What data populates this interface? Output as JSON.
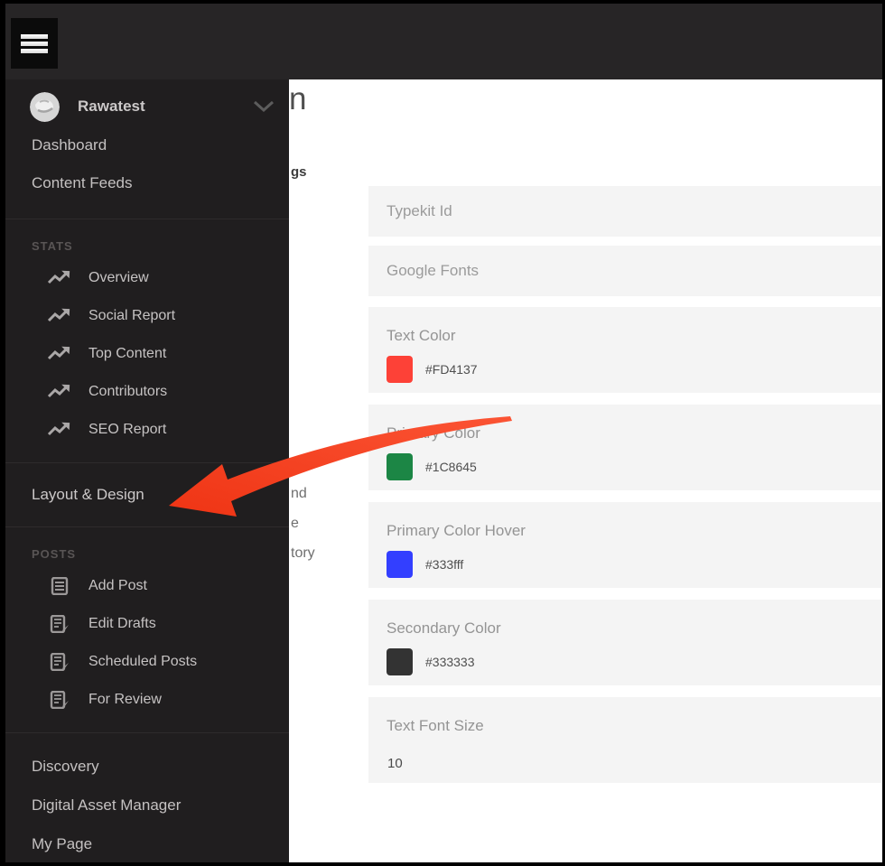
{
  "header": {
    "hamburger_icon": "menu-icon"
  },
  "sidebar": {
    "account": {
      "name": "Rawatest",
      "chevron_icon": "chevron-down"
    },
    "top_items": {
      "dashboard": "Dashboard",
      "content_feeds": "Content Feeds"
    },
    "stats": {
      "title": "STATS",
      "items": [
        "Overview",
        "Social Report",
        "Top Content",
        "Contributors",
        "SEO Report"
      ]
    },
    "layout_design_label": "Layout & Design",
    "posts": {
      "title": "POSTS",
      "items": [
        "Add Post",
        "Edit Drafts",
        "Scheduled Posts",
        "For Review"
      ]
    },
    "bottom_items": [
      "Discovery",
      "Digital Asset Manager",
      "My Page"
    ]
  },
  "main": {
    "page_title_fragment": "n",
    "subheading_fragment": "gs",
    "hidden_menu_fragments": [
      "nd",
      "e",
      "tory"
    ],
    "fields": {
      "typekit": {
        "placeholder": "Typekit Id"
      },
      "google_fonts": {
        "placeholder": "Google Fonts"
      },
      "text_color": {
        "label": "Text Color",
        "value": "#FD4137",
        "swatch": "#FD4137"
      },
      "primary_color": {
        "label": "Primary Color",
        "value": "#1C8645",
        "swatch": "#1C8645"
      },
      "primary_color_hover": {
        "label": "Primary Color Hover",
        "value": "#333fff",
        "swatch": "#333fff"
      },
      "secondary_color": {
        "label": "Secondary Color",
        "value": "#333333",
        "swatch": "#333333"
      },
      "text_font_size": {
        "label": "Text Font Size",
        "value": "10"
      }
    }
  },
  "annotation": {
    "arrow_color_start": "#fb5434",
    "arrow_color_end": "#ef3414",
    "points_to": "Layout & Design"
  }
}
